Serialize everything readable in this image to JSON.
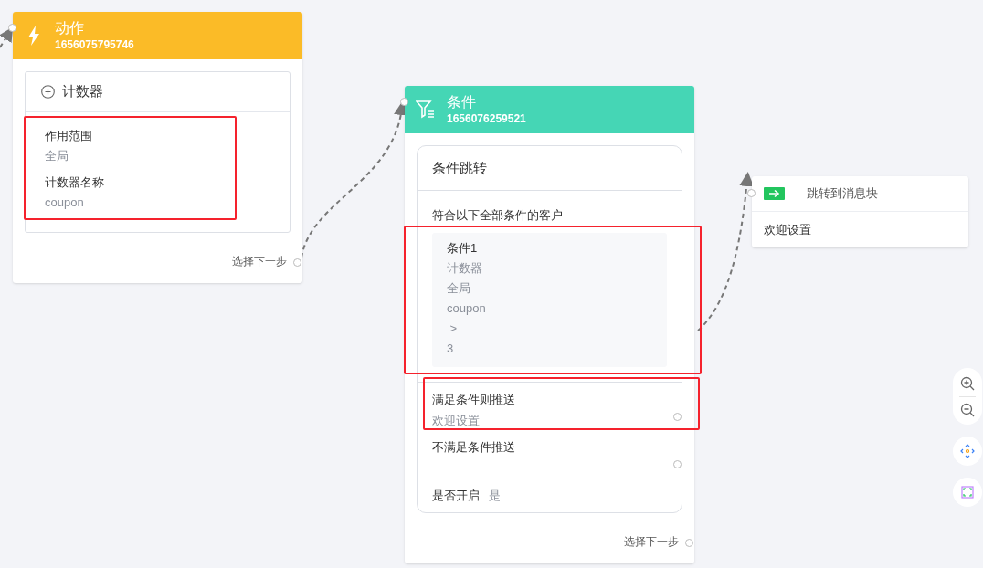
{
  "nodes": [
    {
      "kind": "action",
      "title": "动作",
      "node_id": "1656075795746",
      "card": {
        "title": "计数器",
        "highlight": true,
        "fields": [
          {
            "label": "作用范围",
            "value": "全局"
          },
          {
            "label": "计数器名称",
            "value": "coupon"
          }
        ]
      },
      "next_label": "选择下一步"
    },
    {
      "kind": "condition",
      "title": "条件",
      "node_id": "1656076259521",
      "card": {
        "title": "条件跳转",
        "intro": "符合以下全部条件的客户",
        "condition_block": {
          "highlight": true,
          "title": "条件1",
          "lines": [
            "计数器",
            "全局",
            "coupon",
            " >",
            "3"
          ]
        },
        "branches": [
          {
            "label": "满足条件则推送",
            "target": "欢迎设置",
            "highlight": true
          },
          {
            "label": "不满足条件推送",
            "highlight": false
          }
        ],
        "enabled": {
          "label": "是否开启",
          "value": "是"
        }
      },
      "next_label": "选择下一步"
    },
    {
      "kind": "jump",
      "title": "跳转到消息块",
      "target": "欢迎设置"
    }
  ]
}
